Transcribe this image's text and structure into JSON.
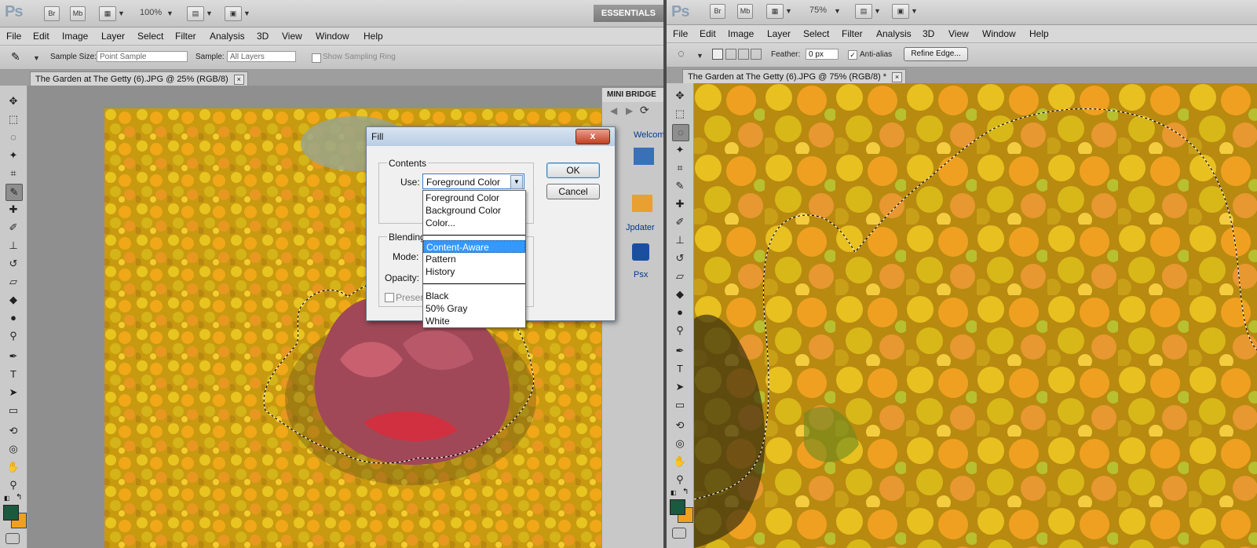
{
  "left": {
    "menu": [
      "File",
      "Edit",
      "Image",
      "Layer",
      "Select",
      "Filter",
      "Analysis",
      "3D",
      "View",
      "Window",
      "Help"
    ],
    "appbar": {
      "zoom": "100%",
      "br": "Br",
      "mb": "Mb",
      "workspace": "ESSENTIALS"
    },
    "options": {
      "sample_size_label": "Sample Size:",
      "sample_size_value": "Point Sample",
      "sample_label": "Sample:",
      "sample_value": "All Layers",
      "sampling_ring_label": "Show Sampling Ring"
    },
    "tab": {
      "title": "The Garden at The Getty (6).JPG @ 25% (RGB/8)",
      "close": "×"
    },
    "mini_bridge": {
      "title": "MINI BRIDGE",
      "welcome": "Welcom",
      "updater": "Jpdater",
      "psx": "Psx"
    }
  },
  "dialog": {
    "title": "Fill",
    "close": "x",
    "contents_label": "Contents",
    "use_label": "Use:",
    "use_value": "Foreground Color",
    "ok": "OK",
    "cancel": "Cancel",
    "blending_label": "Blending",
    "mode_label": "Mode:",
    "opacity_label": "Opacity:",
    "preserve_label": "Preser",
    "options": [
      "Foreground Color",
      "Background Color",
      "Color...",
      "Content-Aware",
      "Pattern",
      "History",
      "Black",
      "50% Gray",
      "White"
    ],
    "selected_option": "Content-Aware"
  },
  "right": {
    "menu": [
      "File",
      "Edit",
      "Image",
      "Layer",
      "Select",
      "Filter",
      "Analysis",
      "3D",
      "View",
      "Window",
      "Help"
    ],
    "appbar": {
      "zoom": "75%",
      "br": "Br",
      "mb": "Mb"
    },
    "options": {
      "feather_label": "Feather:",
      "feather_value": "0 px",
      "antialias_label": "Anti-alias",
      "refine_edge": "Refine Edge..."
    },
    "tab": {
      "title": "The Garden at The Getty (6).JPG @ 75% (RGB/8) *",
      "close": "×"
    }
  },
  "colors": {
    "foreground": "#1a5a3e",
    "background": "#f0a020"
  }
}
